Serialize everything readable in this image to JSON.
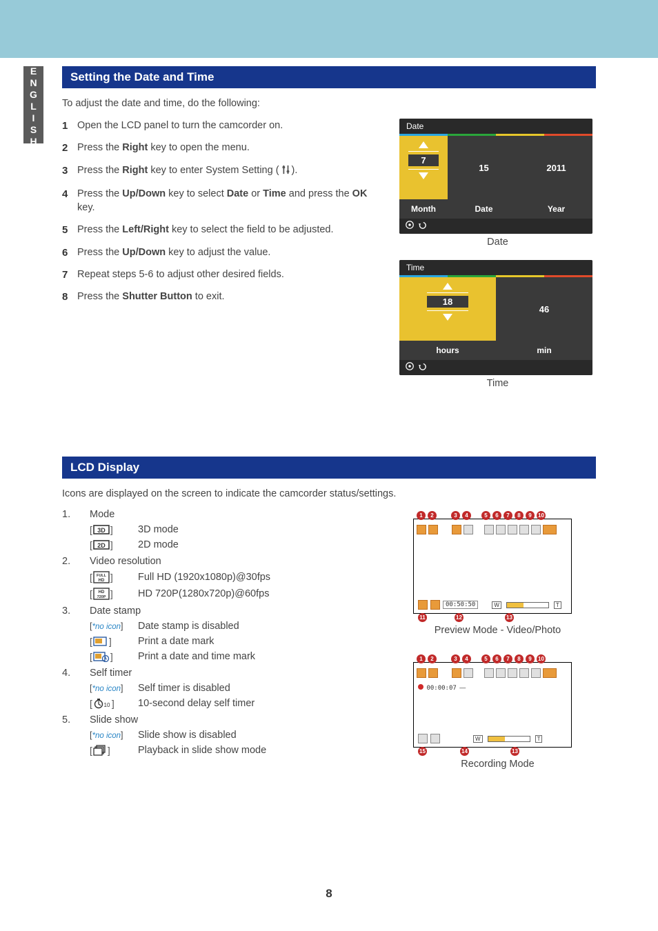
{
  "lang_tab": "ENGLISH",
  "section1": {
    "heading": "Setting the Date and Time",
    "intro": "To adjust the date and time, do the following:",
    "steps": {
      "s1": "Open the LCD panel to turn the camcorder on.",
      "s2a": "Press the ",
      "s2b": "Right",
      "s2c": " key to open the menu.",
      "s3a": "Press the ",
      "s3b": "Right",
      "s3c": " key to enter System Setting (",
      "s3d": ").",
      "s4a": "Press the ",
      "s4b": "Up/Down",
      "s4c": " key to select ",
      "s4d": "Date",
      "s4e": " or ",
      "s4f": "Time",
      "s4g": " and press the ",
      "s4h": "OK",
      "s4i": " key.",
      "s5a": "Press the ",
      "s5b": "Left/Right",
      "s5c": " key to select the field to be adjusted.",
      "s6a": "Press the ",
      "s6b": "Up/Down",
      "s6c": " key to adjust the value.",
      "s7": "Repeat steps 5-6 to adjust other desired fields.",
      "s8a": "Press the ",
      "s8b": "Shutter Button",
      "s8c": " to exit."
    },
    "date_box": {
      "title": "Date",
      "sel_value": "7",
      "cell2_value": "15",
      "cell3_value": "2011",
      "cell1_label": "Month",
      "cell2_label": "Date",
      "cell3_label": "Year"
    },
    "date_caption": "Date",
    "time_box": {
      "title": "Time",
      "sel_value": "18",
      "cell2_value": "46",
      "cell1_label": "hours",
      "cell2_label": "min"
    },
    "time_caption": "Time"
  },
  "section2": {
    "heading": "LCD Display",
    "intro": "Icons are displayed on the screen to indicate the camcorder status/settings.",
    "items": {
      "i1": {
        "num": "1.",
        "title": "Mode",
        "r1": {
          "icon": "3D",
          "desc": "3D mode"
        },
        "r2": {
          "icon": "2D",
          "desc": "2D mode"
        }
      },
      "i2": {
        "num": "2.",
        "title": "Video resolution",
        "r1": {
          "icon": "FULL HD",
          "desc": "Full HD (1920x1080p)@30fps"
        },
        "r2": {
          "icon": "HD 720P",
          "desc": "HD 720P(1280x720p)@60fps"
        }
      },
      "i3": {
        "num": "3.",
        "title": "Date stamp",
        "r1": {
          "no_icon": "*no icon",
          "desc": "Date stamp is disabled"
        },
        "r2": {
          "icon": "D",
          "desc": "Print a date mark"
        },
        "r3": {
          "icon": "DT",
          "desc": "Print a date and time mark"
        }
      },
      "i4": {
        "num": "4.",
        "title": "Self timer",
        "r1": {
          "no_icon": "*no icon",
          "desc": "Self timer is disabled"
        },
        "r2": {
          "icon": "10",
          "desc": "10-second delay self timer"
        }
      },
      "i5": {
        "num": "5.",
        "title": "Slide show",
        "r1": {
          "no_icon": "*no icon",
          "desc": "Slide show is disabled"
        },
        "r2": {
          "icon": "slides",
          "desc": "Playback in slide show mode"
        }
      }
    },
    "badges": [
      "1",
      "2",
      "3",
      "4",
      "5",
      "6",
      "7",
      "8",
      "9",
      "10",
      "11",
      "12",
      "13",
      "14",
      "15"
    ],
    "preview_time": "00:50:50",
    "rec_time": "00:00:07",
    "zoom_w": "W",
    "zoom_t": "T",
    "preview_caption": "Preview Mode - Video/Photo",
    "recording_caption": "Recording Mode"
  },
  "page_number": "8"
}
